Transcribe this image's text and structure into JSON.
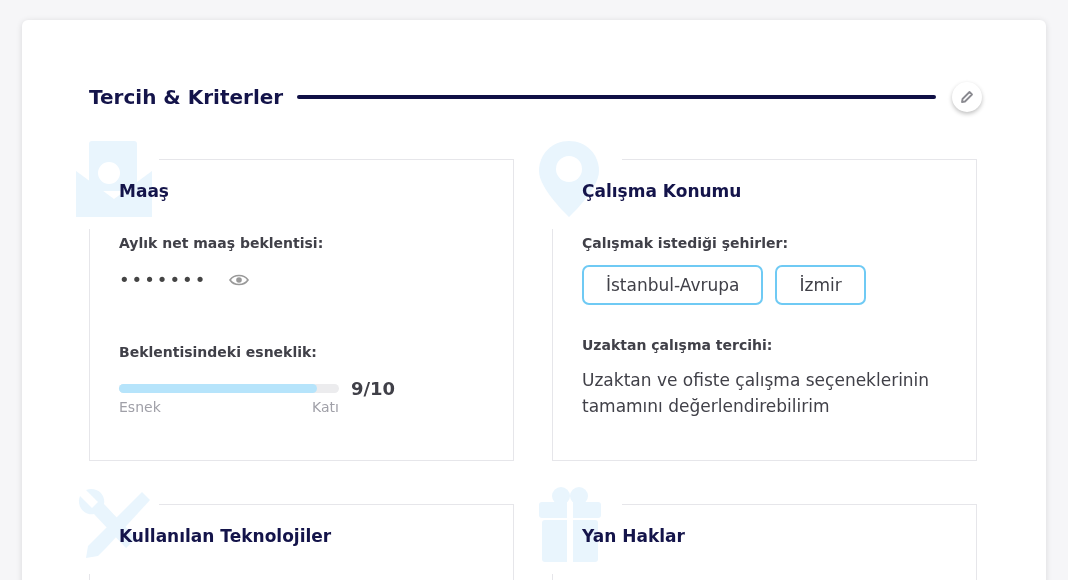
{
  "section": {
    "title": "Tercih & Kriterler"
  },
  "cards": [
    {
      "kind": "salary",
      "title": "Maaş",
      "salary_label": "Aylık net maaş beklentisi:",
      "salary_value": "•••••••",
      "flex_label": "Beklentisindeki esneklik:",
      "level": 0.9,
      "reading": "9/10",
      "min_label": "Esnek",
      "max_label": "Katı"
    },
    {
      "kind": "location",
      "title": "Çalışma Konumu",
      "cities_label": "Çalışmak istediği şehirler:",
      "cities": [
        "İstanbul-Avrupa",
        "İzmir"
      ],
      "remote_label": "Uzaktan çalışma tercihi:",
      "remote_value": "Uzaktan ve ofiste çalışma seçeneklerinin tamamını değerlendirebilirim"
    },
    {
      "kind": "technologies",
      "title": "Kullanılan Teknolojiler"
    },
    {
      "kind": "benefits",
      "title": "Yan Haklar"
    }
  ]
}
